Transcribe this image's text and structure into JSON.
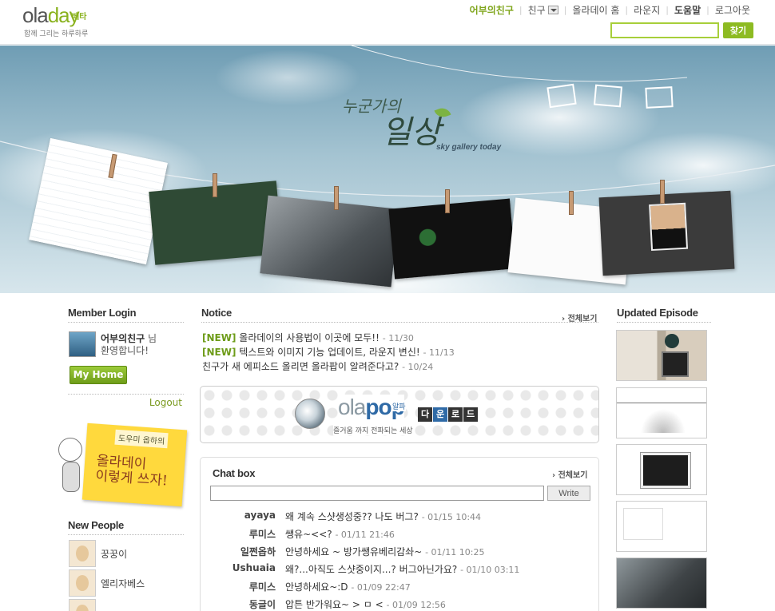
{
  "brand": {
    "logo_ola": "ola",
    "logo_day": "day",
    "beta": "베타",
    "tagline": "함께 그리는 하루하루"
  },
  "nav": {
    "user": "어부의친구",
    "friends": "친구",
    "home": "올라데이 홈",
    "lounge": "라운지",
    "help": "도움말",
    "logout": "로그아웃"
  },
  "search": {
    "value": "",
    "button": "찾기"
  },
  "hero": {
    "title_small": "누군가의",
    "title_large": "일상",
    "subtitle": "sky gallery today"
  },
  "member_login": {
    "heading": "Member Login",
    "user_name": "어부의친구",
    "suffix": "님",
    "welcome": "환영합니다!",
    "myhome": "My Home",
    "logout": "Logout"
  },
  "howto": {
    "tag": "도우미 옵하의",
    "title_line1": "올라데이",
    "title_line2": "이렇게 쓰자!"
  },
  "new_people": {
    "heading": "New People",
    "items": [
      "꿍꿍이",
      "엘리자베스"
    ]
  },
  "notice": {
    "heading": "Notice",
    "more": "전체보기",
    "items": [
      {
        "tag": "[NEW]",
        "text": "올라데이의 사용법이 이곳에 모두!!",
        "date": "- 11/30"
      },
      {
        "tag": "[NEW]",
        "text": "텍스트와 이미지 기능 업데이트, 라운지 변신!",
        "date": "- 11/13"
      },
      {
        "tag": "",
        "text": "친구가 새 에피소드 올리면 올라팝이 알려준다고?",
        "date": "- 10/24"
      }
    ]
  },
  "olapop": {
    "logo_ola": "ola",
    "logo_pop": "pop",
    "alpha": "알파",
    "subtitle": "즐거움 까지 전파되는 세상",
    "download": [
      "다",
      "운",
      "로",
      "드"
    ]
  },
  "chat": {
    "heading": "Chat box",
    "more": "전체보기",
    "input_value": "",
    "write": "Write",
    "rows": [
      {
        "user": "ayaya",
        "msg": "왜 계속 스샷생성중?? 나도 버그?",
        "date": "- 01/15 10:44"
      },
      {
        "user": "루미스",
        "msg": "쌩유~<<?",
        "date": "- 01/11 21:46"
      },
      {
        "user": "일쩐옵하",
        "msg": "안녕하세요 ~ 방가쌩유베리감솨~",
        "date": "- 01/11 10:25"
      },
      {
        "user": "Ushuaia",
        "msg": "왜?...아직도 스샷중이지...? 버그아닌가요?",
        "date": "- 01/10 03:11"
      },
      {
        "user": "루미스",
        "msg": "안녕하세요~:D",
        "date": "- 01/09 22:47"
      },
      {
        "user": "동글이",
        "msg": "압튼 반가워요~ > ㅁ <",
        "date": "- 01/09 12:56"
      }
    ]
  },
  "episodes": {
    "heading": "Updated Episode"
  }
}
